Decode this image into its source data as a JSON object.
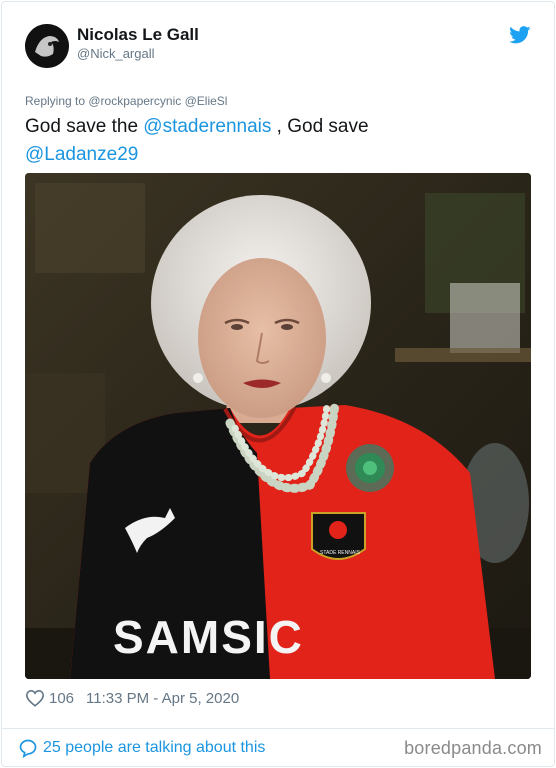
{
  "tweet": {
    "author_name": "Nicolas Le Gall",
    "author_handle": "@Nick_argall",
    "replying_to": "Replying to @rockpapercynic @ElieSl",
    "text_part1": "God save the ",
    "mention1": "@staderennais",
    "text_part2": "  , God save",
    "mention2": "@Ladanze29",
    "like_count": "106",
    "timestamp": "11:33 PM - Apr 5, 2020",
    "talking": "25 people are talking about this"
  },
  "photo": {
    "jersey_sponsor": "SAMSIC",
    "crest_text": "STADE RENNAIS"
  },
  "watermark": "boredpanda.com",
  "colors": {
    "link": "#1b95e0",
    "secondary_text": "#657786",
    "twitter_blue": "#1da1f2",
    "jersey_red": "#e2231a",
    "jersey_black": "#111111"
  },
  "icons": {
    "twitter": "twitter-bird-icon",
    "like": "heart-icon",
    "reply": "comment-bubble-icon"
  }
}
